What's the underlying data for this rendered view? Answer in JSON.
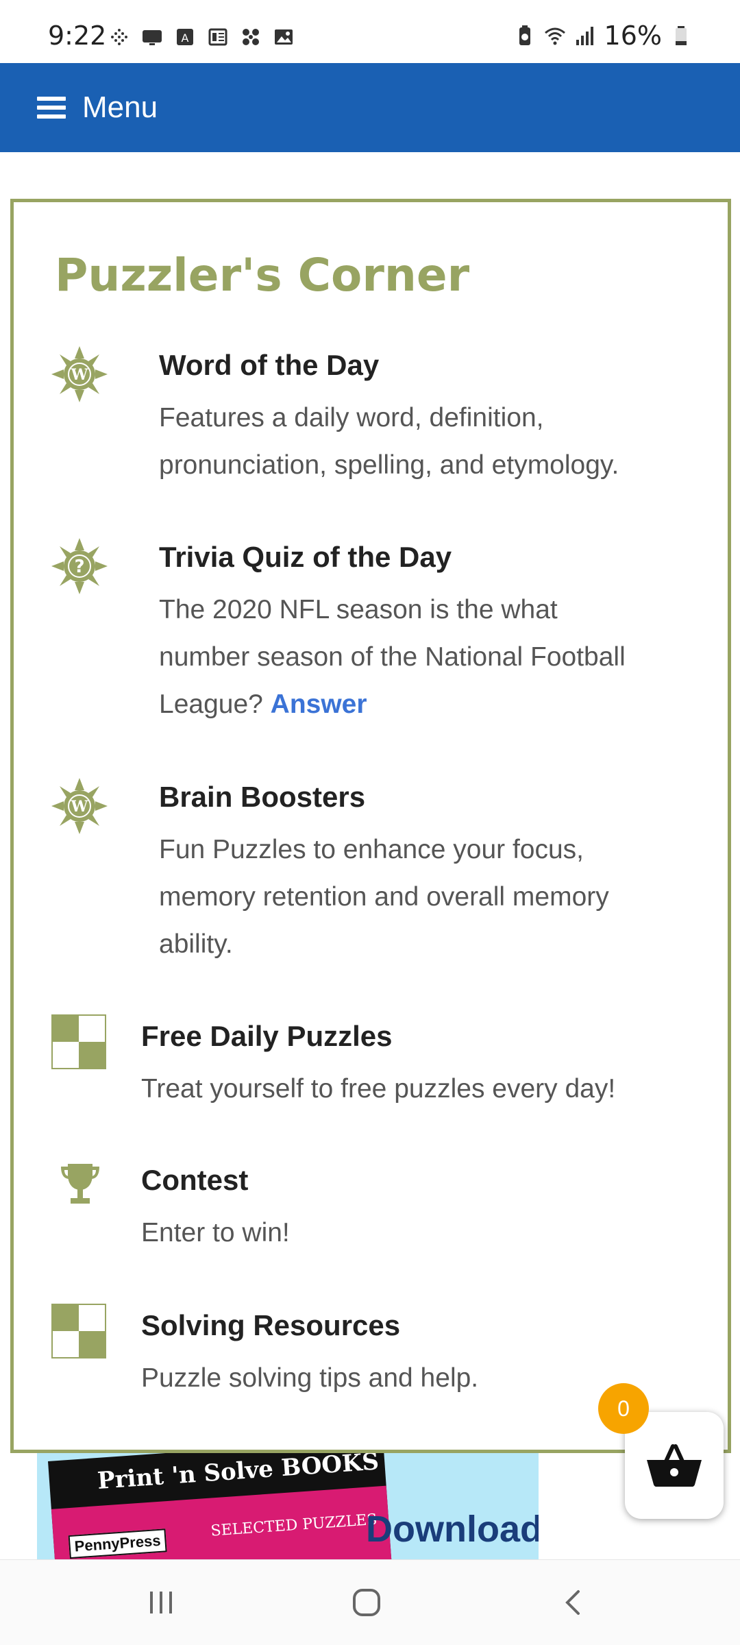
{
  "status_bar": {
    "time": "9:22",
    "battery": "16%",
    "left_icons": [
      "dots-icon",
      "dex-icon",
      "a-box-icon",
      "news-icon",
      "fan-icon",
      "image-icon"
    ],
    "right_icons": [
      "battery-saver-icon",
      "wifi-icon",
      "signal-icon",
      "battery-icon"
    ]
  },
  "menu": {
    "label": "Menu"
  },
  "corner": {
    "title": "Puzzler's Corner",
    "items": [
      {
        "title": "Word of the Day",
        "desc_lines": [
          "Features a daily word, definition,",
          "pronunciation, spelling, and etymology."
        ],
        "icon": "sun-w-icon"
      },
      {
        "title": "Trivia Quiz of the Day",
        "desc_lines": [
          "The 2020 NFL season is the what",
          "number season of the National Football"
        ],
        "desc_last_prefix": "League? ",
        "link": "Answer",
        "icon": "sun-question-icon"
      },
      {
        "title": "Brain Boosters",
        "desc_lines": [
          "Fun Puzzles to enhance your focus,",
          "memory retention and overall memory",
          "ability."
        ],
        "icon": "sun-w-icon"
      },
      {
        "title": "Free Daily Puzzles",
        "desc_lines": [
          "Treat yourself to free puzzles every day!"
        ],
        "icon": "checker-icon"
      },
      {
        "title": "Contest",
        "desc_lines": [
          "Enter to win!"
        ],
        "icon": "trophy-icon"
      },
      {
        "title": "Solving Resources",
        "desc_lines": [
          "Puzzle solving tips and help."
        ],
        "icon": "checker-icon"
      }
    ]
  },
  "ad": {
    "book_title": "Print 'n Solve BOOKS",
    "brand": "PennyPress",
    "selected": "SELECTED PUZZLES",
    "cta": "Download"
  },
  "cart": {
    "count": "0"
  },
  "colors": {
    "menu_bg": "#1a60b3",
    "accent_olive": "#98a462",
    "link_blue": "#3b73d6",
    "badge_orange": "#f7a400"
  }
}
